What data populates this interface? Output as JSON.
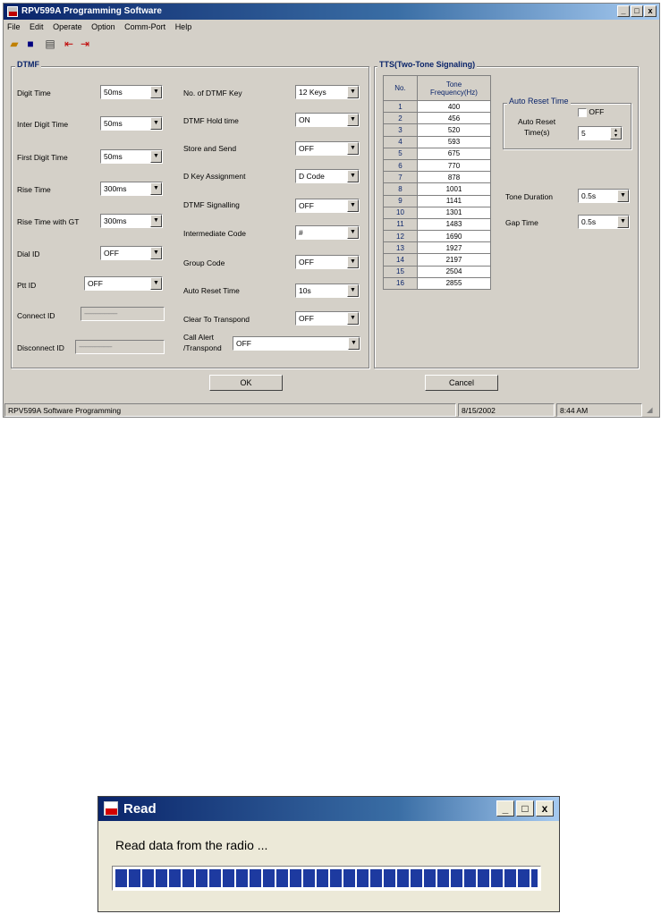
{
  "window": {
    "title": "RPV599A Programming Software",
    "controls": [
      "_",
      "□",
      "x"
    ]
  },
  "menu": [
    "File",
    "Edit",
    "Operate",
    "Option",
    "Comm-Port",
    "Help"
  ],
  "toolbar_icons": [
    "open-folder-icon",
    "save-disk-icon",
    "print-icon",
    "read-radio-icon",
    "write-radio-icon"
  ],
  "dtmf": {
    "title": "DTMF",
    "left": [
      {
        "label": "Digit Time",
        "value": "50ms"
      },
      {
        "label": "Inter Digit Time",
        "value": "50ms"
      },
      {
        "label": "First Digit Time",
        "value": "50ms"
      },
      {
        "label": "Rise Time",
        "value": "300ms"
      },
      {
        "label": "Rise Time with GT",
        "value": "300ms"
      },
      {
        "label": "Dial ID",
        "value": "OFF"
      },
      {
        "label": "Ptt ID",
        "value": "OFF"
      }
    ],
    "connect_id": {
      "label": "Connect ID",
      "value": "----------------------"
    },
    "disconnect_id": {
      "label": "Disconnect ID",
      "value": "----------------------"
    },
    "right": [
      {
        "label": "No. of DTMF Key",
        "value": "12 Keys"
      },
      {
        "label": "DTMF Hold time",
        "value": "ON"
      },
      {
        "label": "Store and Send",
        "value": "OFF"
      },
      {
        "label": "D Key Assignment",
        "value": "D Code"
      },
      {
        "label": "DTMF Signalling",
        "value": "OFF"
      },
      {
        "label": "Intermediate Code",
        "value": "#"
      },
      {
        "label": "Group Code",
        "value": "OFF"
      },
      {
        "label": "Auto Reset Time",
        "value": "10s"
      },
      {
        "label": "Clear To Transpond",
        "value": "OFF"
      }
    ],
    "call_alert": {
      "label1": "Call Alert",
      "label2": "/Transpond",
      "value": "OFF"
    }
  },
  "tts": {
    "title": "TTS(Two-Tone Signaling)",
    "col_no": "No.",
    "col_freq1": "Tone",
    "col_freq2": "Frequency(Hz)",
    "rows": [
      [
        "1",
        "400"
      ],
      [
        "2",
        "456"
      ],
      [
        "3",
        "520"
      ],
      [
        "4",
        "593"
      ],
      [
        "5",
        "675"
      ],
      [
        "6",
        "770"
      ],
      [
        "7",
        "878"
      ],
      [
        "8",
        "1001"
      ],
      [
        "9",
        "1141"
      ],
      [
        "10",
        "1301"
      ],
      [
        "11",
        "1483"
      ],
      [
        "12",
        "1690"
      ],
      [
        "13",
        "1927"
      ],
      [
        "14",
        "2197"
      ],
      [
        "15",
        "2504"
      ],
      [
        "16",
        "2855"
      ]
    ],
    "auto_reset": {
      "title": "Auto Reset Time",
      "label1": "Auto Reset",
      "label2": "Time(s)",
      "off_label": "OFF",
      "value": "5"
    },
    "tone_duration": {
      "label": "Tone Duration",
      "value": "0.5s"
    },
    "gap_time": {
      "label": "Gap Time",
      "value": "0.5s"
    }
  },
  "buttons": {
    "ok": "OK",
    "cancel": "Cancel"
  },
  "status": {
    "text": "RPV599A Software Programming",
    "date": "8/15/2002",
    "time": "8:44 AM"
  },
  "read_dialog": {
    "title": "Read",
    "controls": [
      "_",
      "□",
      "x"
    ],
    "message": "Read data from the radio ...",
    "progress": 1.0
  }
}
